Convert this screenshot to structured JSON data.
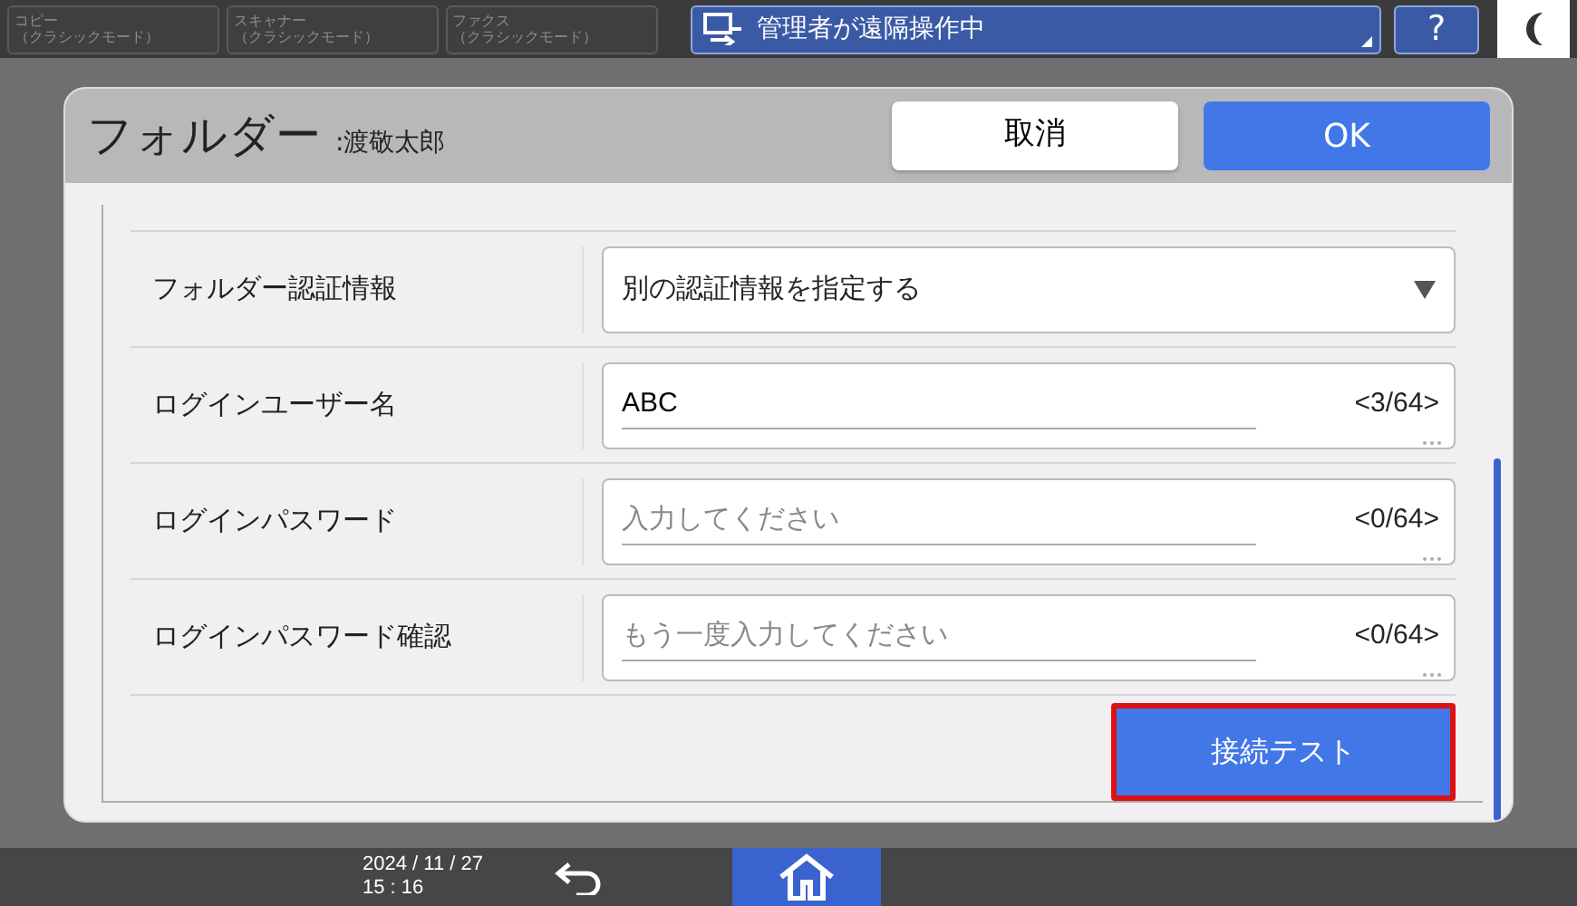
{
  "top_tabs": [
    {
      "line1": "コピー",
      "line2": "（クラシックモード）"
    },
    {
      "line1": "スキャナー",
      "line2": "（クラシックモード）"
    },
    {
      "line1": "ファクス",
      "line2": "（クラシックモード）"
    }
  ],
  "status": {
    "text": "管理者が遠隔操作中"
  },
  "help_button": {
    "label": "?"
  },
  "dialog": {
    "title": "フォルダー",
    "subtitle": ":渡敬太郎",
    "cancel": "取消",
    "ok": "OK",
    "rows": [
      {
        "kind": "select",
        "label": "フォルダー認証情報",
        "value": "別の認証情報を指定する"
      },
      {
        "kind": "text",
        "label": "ログインユーザー名",
        "value": "ABC",
        "counter": "<3/64>"
      },
      {
        "kind": "text",
        "label": "ログインパスワード",
        "placeholder": "入力してください",
        "counter": "<0/64>"
      },
      {
        "kind": "text",
        "label": "ログインパスワード確認",
        "placeholder": "もう一度入力してください",
        "counter": "<0/64>"
      }
    ],
    "test_button": {
      "label": "接続テスト",
      "focused": true
    }
  },
  "bottom_bar": {
    "date": "2024 / 11 / 27",
    "time": "15 : 16"
  }
}
